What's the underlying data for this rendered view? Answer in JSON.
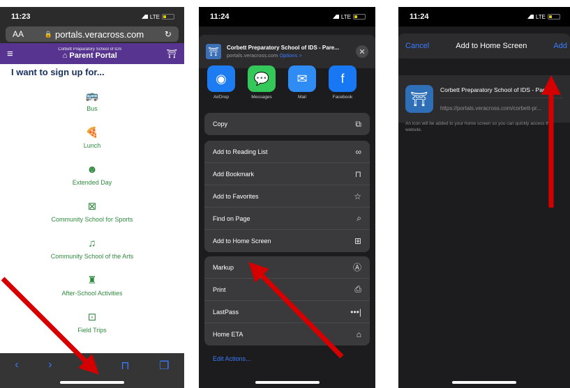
{
  "panel1": {
    "time": "11:23",
    "network": "LTE",
    "url": "portals.veracross.com",
    "text_size_label": "AA",
    "reload_icon": "reload-icon",
    "school_name": "Corbett Preparatory School of IDS",
    "portal_title": "Parent Portal",
    "heading": "I want to sign up for...",
    "items": [
      {
        "label": "Bus",
        "icon": "bus-icon",
        "glyph": "🚌"
      },
      {
        "label": "Lunch",
        "icon": "pizza-icon",
        "glyph": "🍕"
      },
      {
        "label": "Extended Day",
        "icon": "smile-icon",
        "glyph": "☻"
      },
      {
        "label": "Community School for Sports",
        "icon": "basketball-hoop-icon",
        "glyph": "⊠"
      },
      {
        "label": "Community School of the Arts",
        "icon": "music-note-icon",
        "glyph": "♫"
      },
      {
        "label": "After-School Activities",
        "icon": "chess-rook-icon",
        "glyph": "♜"
      },
      {
        "label": "Field Trips",
        "icon": "map-icon",
        "glyph": "⊡"
      }
    ],
    "toolbar": {
      "back": "‹",
      "forward": "›",
      "share": "⇪",
      "bookmarks": "⊓",
      "tabs": "❐"
    }
  },
  "panel2": {
    "time": "11:24",
    "network": "LTE",
    "site_title": "Corbett Preparatory School of IDS - Pare...",
    "site_domain": "portals.veracross.com",
    "options_label": "Options >",
    "close_label": "✕",
    "apps": [
      {
        "label": "AirDrop",
        "icon": "airdrop-icon",
        "glyph": "◉",
        "color": "#1e7cf2"
      },
      {
        "label": "Messages",
        "icon": "messages-icon",
        "glyph": "💬",
        "color": "#34c759"
      },
      {
        "label": "Mail",
        "icon": "mail-icon",
        "glyph": "✉",
        "color": "#2f8cf5"
      },
      {
        "label": "Facebook",
        "icon": "facebook-icon",
        "glyph": "f",
        "color": "#1877f2"
      }
    ],
    "group1": [
      {
        "label": "Copy",
        "icon": "copy-icon",
        "glyph": "⧉"
      }
    ],
    "group2": [
      {
        "label": "Add to Reading List",
        "icon": "glasses-icon",
        "glyph": "∞"
      },
      {
        "label": "Add Bookmark",
        "icon": "book-icon",
        "glyph": "⊓"
      },
      {
        "label": "Add to Favorites",
        "icon": "star-icon",
        "glyph": "☆"
      },
      {
        "label": "Find on Page",
        "icon": "search-icon",
        "glyph": "⌕"
      },
      {
        "label": "Add to Home Screen",
        "icon": "plus-square-icon",
        "glyph": "⊞"
      }
    ],
    "group3": [
      {
        "label": "Markup",
        "icon": "markup-icon",
        "glyph": "Ⓐ"
      },
      {
        "label": "Print",
        "icon": "print-icon",
        "glyph": "⎙"
      },
      {
        "label": "LastPass",
        "icon": "lastpass-icon",
        "glyph": "•••|"
      },
      {
        "label": "Home ETA",
        "icon": "home-icon",
        "glyph": "⌂"
      }
    ],
    "edit_actions": "Edit Actions..."
  },
  "panel3": {
    "time": "11:24",
    "network": "LTE",
    "cancel": "Cancel",
    "title": "Add to Home Screen",
    "add": "Add",
    "app_name": "Corbett Preparatory School of IDS - Pare...",
    "app_url": "https://portals.veracross.com/corbett-pr...",
    "note": "An icon will be added to your home screen so you can quickly access this website."
  },
  "colors": {
    "accent_blue": "#3a7cff",
    "portal_purple": "#56348f",
    "menu_green": "#2f8a3e",
    "arrow_red": "#d40000"
  }
}
